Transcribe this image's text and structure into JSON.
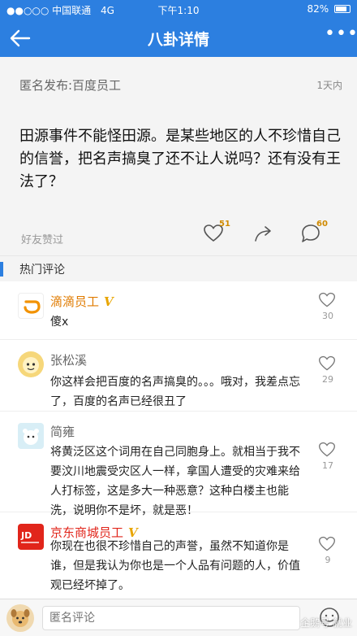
{
  "status": {
    "carrier": "●●○○○ 中国联通",
    "network": "4G",
    "time": "下午1:10",
    "battery": "82%"
  },
  "header": {
    "title": "八卦详情"
  },
  "post": {
    "author": "匿名发布:百度员工",
    "time": "1天内",
    "content": "田源事件不能怪田源。是某些地区的人不珍惜自己的信誉，把名声搞臭了还不让人说吗？还有没有王法了？",
    "friends_liked": "好友赞过",
    "like_count": "51",
    "comment_count": "60"
  },
  "hot_comments": {
    "heading": "热门评论",
    "items": [
      {
        "name": "滴滴员工",
        "verified": "V",
        "text": "傻x",
        "likes": "30"
      },
      {
        "name": "张松溪",
        "text": "你这样会把百度的名声搞臭的。。。哦对，我差点忘了，百度的名声已经很丑了",
        "likes": "29"
      },
      {
        "name": "简雍",
        "text": "将黄泛区这个词用在自己同胞身上。就相当于我不要汶川地震受灾区人一样，拿国人遭受的灾难来给人打标签，这是多大一种恶意？这种白楼主也能洗，说明你不是坏，就是恶！",
        "likes": "17"
      },
      {
        "name": "京东商城员工",
        "verified": "V",
        "text": "你现在也很不珍惜自己的声誉，虽然不知道你是谁，但是我认为你也是一个人品有问题的人，价值观已经坏掉了。",
        "likes": "9"
      }
    ]
  },
  "bottom": {
    "input_placeholder": "匿名评论",
    "watermark": "企鹅号 就业"
  },
  "colors": {
    "brand_blue": "#2c7fe0",
    "verified_gold": "#e8a500",
    "count_orange": "#d08a00"
  },
  "icons": [
    "back-arrow-icon",
    "more-icon",
    "heart-icon",
    "share-icon",
    "comment-icon",
    "emoji-icon"
  ]
}
